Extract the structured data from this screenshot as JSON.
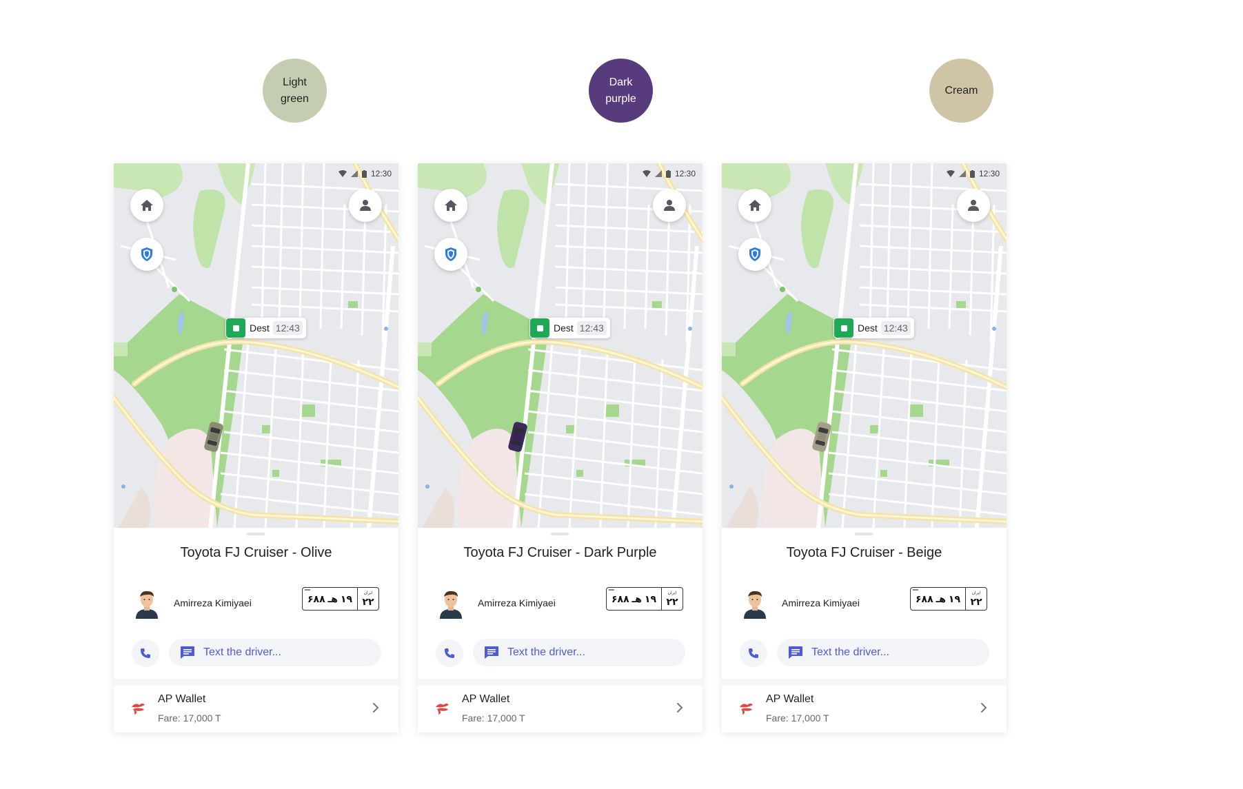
{
  "colors_row": [
    {
      "label_line1": "Light",
      "label_line2": "green",
      "swatch_color": "#c4cdb2",
      "text_color": "#222222"
    },
    {
      "label_line1": "Dark",
      "label_line2": "purple",
      "swatch_color": "#583b7c",
      "text_color": "#ffffff"
    },
    {
      "label_line1": "Cream",
      "label_line2": "",
      "swatch_color": "#cfc5a6",
      "text_color": "#222222"
    }
  ],
  "screens": [
    {
      "status": {
        "time": "12:30"
      },
      "marker": {
        "label": "Dest",
        "time": "12:43"
      },
      "car_color": "#8a8c74",
      "car_title": "Toyota FJ Cruiser - Olive",
      "driver_name": "Amirreza Kimiyaei",
      "plate": {
        "main": "۱۹ هـ ۶۸۸",
        "region_label": "ایران",
        "region_number": "۲۲"
      },
      "message": {
        "placeholder": "Text the driver..."
      },
      "payment": {
        "method": "AP Wallet",
        "fare": "Fare: 17,000 T"
      }
    },
    {
      "status": {
        "time": "12:30"
      },
      "marker": {
        "label": "Dest",
        "time": "12:43"
      },
      "car_color": "#3b2a5e",
      "car_title": "Toyota FJ Cruiser - Dark Purple",
      "driver_name": "Amirreza Kimiyaei",
      "plate": {
        "main": "۱۹ هـ ۶۸۸",
        "region_label": "ایران",
        "region_number": "۲۲"
      },
      "message": {
        "placeholder": "Text the driver..."
      },
      "payment": {
        "method": "AP Wallet",
        "fare": "Fare: 17,000 T"
      }
    },
    {
      "status": {
        "time": "12:30"
      },
      "marker": {
        "label": "Dest",
        "time": "12:43"
      },
      "car_color": "#a59f8a",
      "car_title": "Toyota FJ Cruiser - Beige",
      "driver_name": "Amirreza Kimiyaei",
      "plate": {
        "main": "۱۹ هـ ۶۸۸",
        "region_label": "ایران",
        "region_number": "۲۲"
      },
      "message": {
        "placeholder": "Text the driver..."
      },
      "payment": {
        "method": "AP Wallet",
        "fare": "Fare: 17,000 T"
      }
    }
  ],
  "icons": {
    "home": "home-icon",
    "profile": "user-icon",
    "safety": "shield-icon",
    "phone": "phone-icon",
    "message": "message-icon",
    "wallet": "wallet-logo-icon",
    "chevron": "chevron-right-icon"
  },
  "accent": "#4f5ad9",
  "dest_green": "#1fa855"
}
